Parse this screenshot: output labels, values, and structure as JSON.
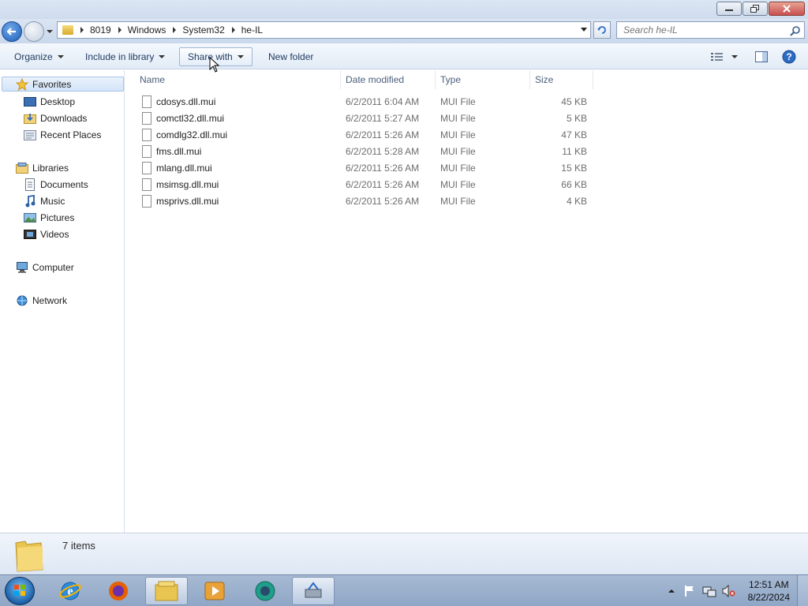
{
  "window": {
    "minimize_icon": "minimize-icon",
    "maximize_icon": "restore-icon",
    "close_icon": "close-icon"
  },
  "address": {
    "crumbs": [
      "8019",
      "Windows",
      "System32",
      "he-IL"
    ],
    "search_placeholder": "Search he-IL"
  },
  "commands": {
    "organize": "Organize",
    "include_in_library": "Include in library",
    "share_with": "Share with",
    "new_folder": "New folder"
  },
  "nav": {
    "favorites": "Favorites",
    "desktop": "Desktop",
    "downloads": "Downloads",
    "recent_places": "Recent Places",
    "libraries": "Libraries",
    "documents": "Documents",
    "music": "Music",
    "pictures": "Pictures",
    "videos": "Videos",
    "computer": "Computer",
    "network": "Network"
  },
  "columns": {
    "name": "Name",
    "date_modified": "Date modified",
    "type": "Type",
    "size": "Size"
  },
  "files": [
    {
      "name": "cdosys.dll.mui",
      "date": "6/2/2011 6:04 AM",
      "type": "MUI File",
      "size": "45 KB"
    },
    {
      "name": "comctl32.dll.mui",
      "date": "6/2/2011 5:27 AM",
      "type": "MUI File",
      "size": "5 KB"
    },
    {
      "name": "comdlg32.dll.mui",
      "date": "6/2/2011 5:26 AM",
      "type": "MUI File",
      "size": "47 KB"
    },
    {
      "name": "fms.dll.mui",
      "date": "6/2/2011 5:28 AM",
      "type": "MUI File",
      "size": "11 KB"
    },
    {
      "name": "mlang.dll.mui",
      "date": "6/2/2011 5:26 AM",
      "type": "MUI File",
      "size": "15 KB"
    },
    {
      "name": "msimsg.dll.mui",
      "date": "6/2/2011 5:26 AM",
      "type": "MUI File",
      "size": "66 KB"
    },
    {
      "name": "msprivs.dll.mui",
      "date": "6/2/2011 5:26 AM",
      "type": "MUI File",
      "size": "4 KB"
    }
  ],
  "details": {
    "item_count": "7 items"
  },
  "taskbar": {
    "time": "12:51 AM",
    "date": "8/22/2024"
  },
  "colors": {
    "accent": "#1f5fb7",
    "selection": "#d4e4f8"
  }
}
